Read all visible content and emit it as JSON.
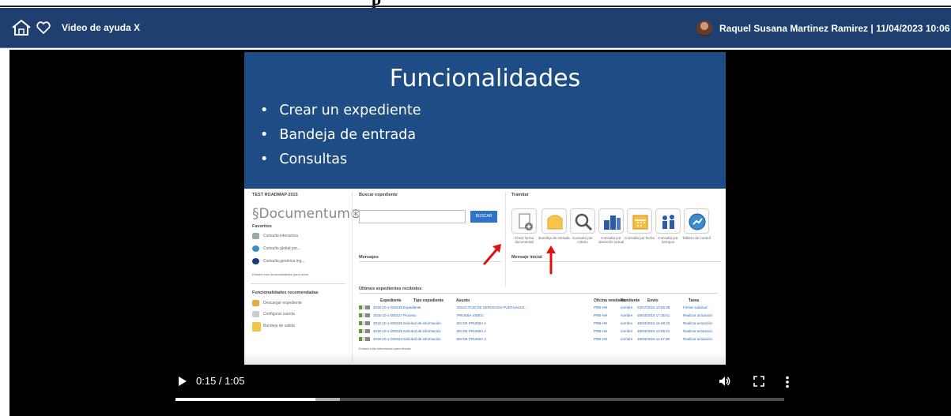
{
  "window": {
    "clipped_title": "p"
  },
  "header": {
    "video_tab": "Video de ayuda X",
    "user_info": "Raquel Susana Martinez Ramirez | 11/04/2023 10:06",
    "icons": [
      "home-icon",
      "heart-icon",
      "avatar"
    ]
  },
  "slide": {
    "title": "Funcionalidades",
    "bullets": [
      "Crear un expediente",
      "Bandeja de entrada",
      "Consultas"
    ],
    "colors": {
      "banner": "#1e4c84",
      "text": "#ffffff",
      "arrow": "#e01010"
    }
  },
  "embedded_app": {
    "user_label": "TEST ROADMAP 2015",
    "logo": "Documentum",
    "favorites_title": "Favoritos",
    "favorites": [
      "Consulta interactiva",
      "Consulta global por...",
      "Consulta genérica ing..."
    ],
    "favorites_note": "Existen más funcionalidades para volver",
    "recommended_title": "Funcionalidades recomendadas",
    "recommended": [
      "Descargar expediente",
      "Configurar cuenta",
      "Bandeja de salida"
    ],
    "search_title": "Buscar expediente",
    "search_button": "BUSCAR",
    "tramitar_title": "Tramitar",
    "tiles": [
      "Crear forma documental",
      "Bandeja de entrada",
      "Consulta por criterio",
      "Consulta por ubicación actual",
      "Consulta por fecha",
      "Consulta por tiempos",
      "Tablero de control"
    ],
    "mensajes_title": "Mensajes",
    "mensaje_inicial_title": "Mensaje inicial",
    "recent_title": "Últimos expedientes recibidos",
    "table_headers": [
      "Expediente",
      "Tipo expediente",
      "Asunto",
      "Oficina remitente",
      "Remitente",
      "Envío",
      "Tarea"
    ],
    "rows": [
      [
        "2016-10-1-000235",
        "Expediente",
        "SOLICITUD DE SERVICIOS PUNTUALES...",
        "PRB-HH",
        "nombre",
        "03/07/2016 10:55:28",
        "Firmar solicitud"
      ],
      [
        "2016-10-1-000227",
        "Proceso",
        "PRUEBA VIDEO",
        "PRB-HH",
        "nombre",
        "18/03/2016 17:35:51",
        "Realizar actuación"
      ],
      [
        "2016-10-1-000226",
        "Solicitud de información",
        "BS DE PRUEBA 1",
        "PRB-HH",
        "nombre",
        "18/03/2016 16:48:33",
        "Realizar actuación"
      ],
      [
        "2016-10-1-000225",
        "Solicitud de información",
        "BS DE PRUEBA 2",
        "PRB-HH",
        "nombre",
        "18/03/2016 12:55:41",
        "Realizar actuación"
      ],
      [
        "2016-10-1-000224",
        "Solicitud de información",
        "BS DE PRUEBA 3",
        "PRB-HH",
        "nombre",
        "18/03/2016 11:27:36",
        "Realizar actuación"
      ]
    ],
    "table_note": "Existen más información para revisar"
  },
  "player": {
    "time": "0:15 / 1:05",
    "progress_fraction": 0.23,
    "buffered_fraction": 0.27,
    "icons": [
      "play-icon",
      "volume-icon",
      "fullscreen-icon",
      "more-icon"
    ]
  }
}
